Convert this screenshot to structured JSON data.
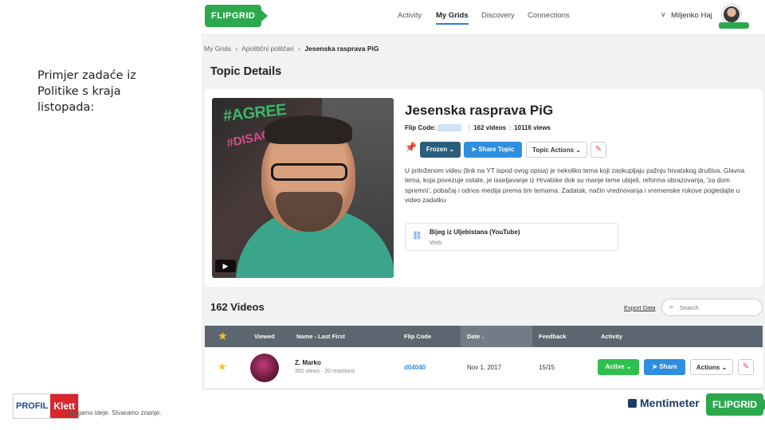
{
  "caption": "Primjer zadaće iz Politike s kraja listopada:",
  "topnav": {
    "logo": "FLIPGRID",
    "links": [
      "Activity",
      "My Grids",
      "Discovery",
      "Connections"
    ],
    "active_link": "My Grids",
    "user_chevron": "∨",
    "user_name": "Miljenko Haj"
  },
  "breadcrumb": [
    "My Grids",
    "Apolitični politčari",
    "Jesenska rasprava PiG"
  ],
  "page_title": "Topic Details",
  "topic": {
    "thumb_sticker_agree": "#AGREE",
    "thumb_sticker_disagree": "#DISAGREE",
    "title": "Jesenska rasprava PiG",
    "flip_code_label": "Flip Code:",
    "videos_count": "162 videos",
    "views_count": "10116 views",
    "frozen_label": "Frozen",
    "share_topic_label": "Share Topic",
    "topic_actions_label": "Topic Actions",
    "description": "U priloženom videu (link na YT ispod ovog opisa) je nekoliko tema koji zaokupljaju pažnju hrvatskog društva. Glavna tema, koja povezuje ostale, je isseljavanje iz Hrvatske dok su manje teme ubijeli, reforma obrazovanja, 'za dom spremni', pobačaj i odnos medija prema tim temama. Zadatak, način vrednovanja i vremenske rokove pogledajte u video zadatku",
    "resource_title": "Bijeg iz Uljebistana (YouTube)",
    "resource_sub": "Web"
  },
  "videos": {
    "title": "162 Videos",
    "export_label": "Export Data",
    "search_placeholder": "Search",
    "columns": [
      "Viewed",
      "Name - Last First",
      "Flip Code",
      "Date ↓",
      "Feedback",
      "Activity"
    ],
    "rows": [
      {
        "name": "Z. Marko",
        "stats": "392 views · 20 reactions",
        "flip_code": "d04040",
        "date": "Nov 1, 2017",
        "feedback": "15/15",
        "active_label": "Active",
        "share_label": "Share",
        "actions_label": "Actions"
      }
    ]
  },
  "footer": {
    "profil": "PROFIL",
    "klett": "Klett",
    "slogan": "Spajamo ideje. Stvaramo znanje.",
    "mentimeter": "Mentimeter",
    "flipgrid": "FLIPGRID"
  },
  "colors": {
    "flipgrid_green": "#2ea84f",
    "share_blue": "#2e8ee0",
    "frozen_navy": "#2a5e7c",
    "header_gray": "#5c6670",
    "active_green": "#2ec04e"
  }
}
